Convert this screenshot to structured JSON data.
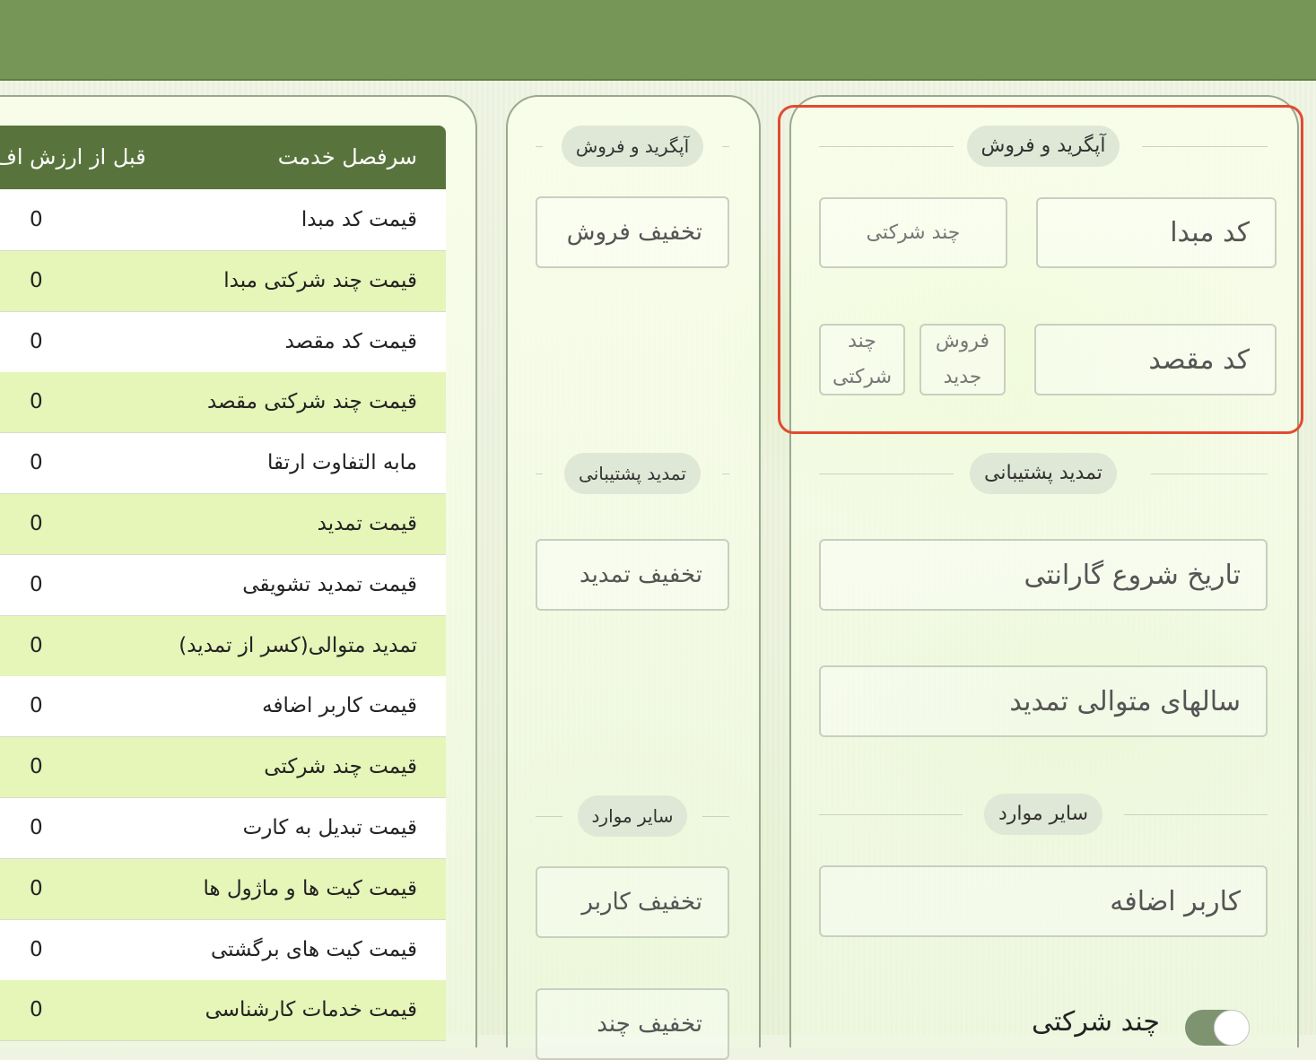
{
  "header": {
    "color": "#769657"
  },
  "left_table": {
    "columns": [
      "سرفصل خدمت",
      "قبل از ارزش اف"
    ],
    "rows": [
      {
        "name": "قیمت کد مبدا",
        "value": "0"
      },
      {
        "name": "قیمت چند شرکتی مبدا",
        "value": "0"
      },
      {
        "name": "قیمت کد مقصد",
        "value": "0"
      },
      {
        "name": "قیمت چند شرکتی مقصد",
        "value": "0"
      },
      {
        "name": "مابه التفاوت ارتقا",
        "value": "0"
      },
      {
        "name": "قیمت تمدید",
        "value": "0"
      },
      {
        "name": "قیمت تمدید تشویقی",
        "value": "0"
      },
      {
        "name": "تمدید متوالی(کسر از تمدید)",
        "value": "0"
      },
      {
        "name": "قیمت کاربر اضافه",
        "value": "0"
      },
      {
        "name": "قیمت چند شرکتی",
        "value": "0"
      },
      {
        "name": "قیمت تبدیل به کارت",
        "value": "0"
      },
      {
        "name": "قیمت کیت ها و ماژول ها",
        "value": "0"
      },
      {
        "name": "قیمت کیت های برگشتی",
        "value": "0"
      },
      {
        "name": "قیمت خدمات کارشناسی",
        "value": "0"
      }
    ]
  },
  "middle_panel": {
    "sections": [
      "آپگرید و فروش",
      "تمدید پشتیبانی",
      "سایر موارد"
    ],
    "fields": [
      "تخفیف فروش",
      "تخفیف تمدید",
      "تخفیف کاربر",
      "تخفیف چند"
    ]
  },
  "right_panel": {
    "sections": [
      "آپگرید و فروش",
      "تمدید پشتیبانی",
      "سایر موارد"
    ],
    "source_code": "کد مبدا",
    "multi_company": "چند شرکتی",
    "dest_code": "کد مقصد",
    "new_sale": "فروش جدید",
    "multi_company_2": "چند شرکتی",
    "warranty_start": "تاریخ شروع گارانتی",
    "consecutive_years": "سالهای متوالی تمدید",
    "extra_user": "کاربر اضافه",
    "multi_company_toggle_label": "چند شرکتی",
    "multi_company_toggle_on": true
  }
}
